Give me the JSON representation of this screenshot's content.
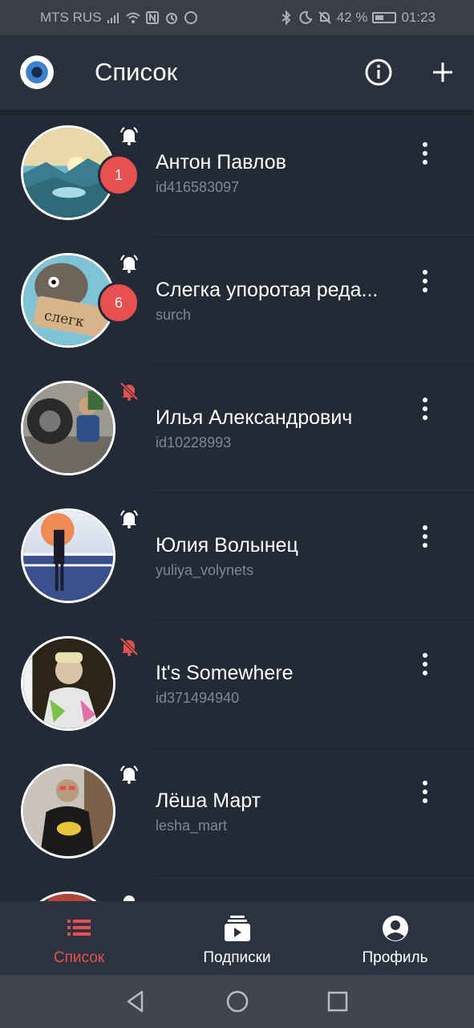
{
  "status_bar": {
    "carrier": "MTS RUS",
    "battery": "42 %",
    "time": "01:23"
  },
  "header": {
    "title": "Список",
    "icons": [
      "app-logo",
      "info-icon",
      "plus-icon"
    ]
  },
  "items": [
    {
      "title": "Антон Павлов",
      "subtitle": "id416583097",
      "badge": "1",
      "notifications": "on",
      "avatar": "mountains"
    },
    {
      "title": "Слегка упоротая реда...",
      "subtitle": "surch",
      "badge": "6",
      "notifications": "on",
      "avatar": "cartoon"
    },
    {
      "title": "Илья Александрович",
      "subtitle": "id10228993",
      "badge": "",
      "notifications": "off",
      "avatar": "child"
    },
    {
      "title": "Юлия Волынец",
      "subtitle": "yuliya_volynets",
      "badge": "",
      "notifications": "on",
      "avatar": "sunset"
    },
    {
      "title": "It's Somewhere",
      "subtitle": "id371494940",
      "badge": "",
      "notifications": "off",
      "avatar": "person"
    },
    {
      "title": "Лёша Март",
      "subtitle": "lesha_mart",
      "badge": "",
      "notifications": "on",
      "avatar": "street"
    }
  ],
  "bottom_nav": {
    "list_label": "Список",
    "subscriptions_label": "Подписки",
    "profile_label": "Профиль"
  },
  "colors": {
    "accent": "#e8504f",
    "background": "#222a35",
    "app_bar": "#29313d",
    "bottom_nav": "#2b3340"
  }
}
